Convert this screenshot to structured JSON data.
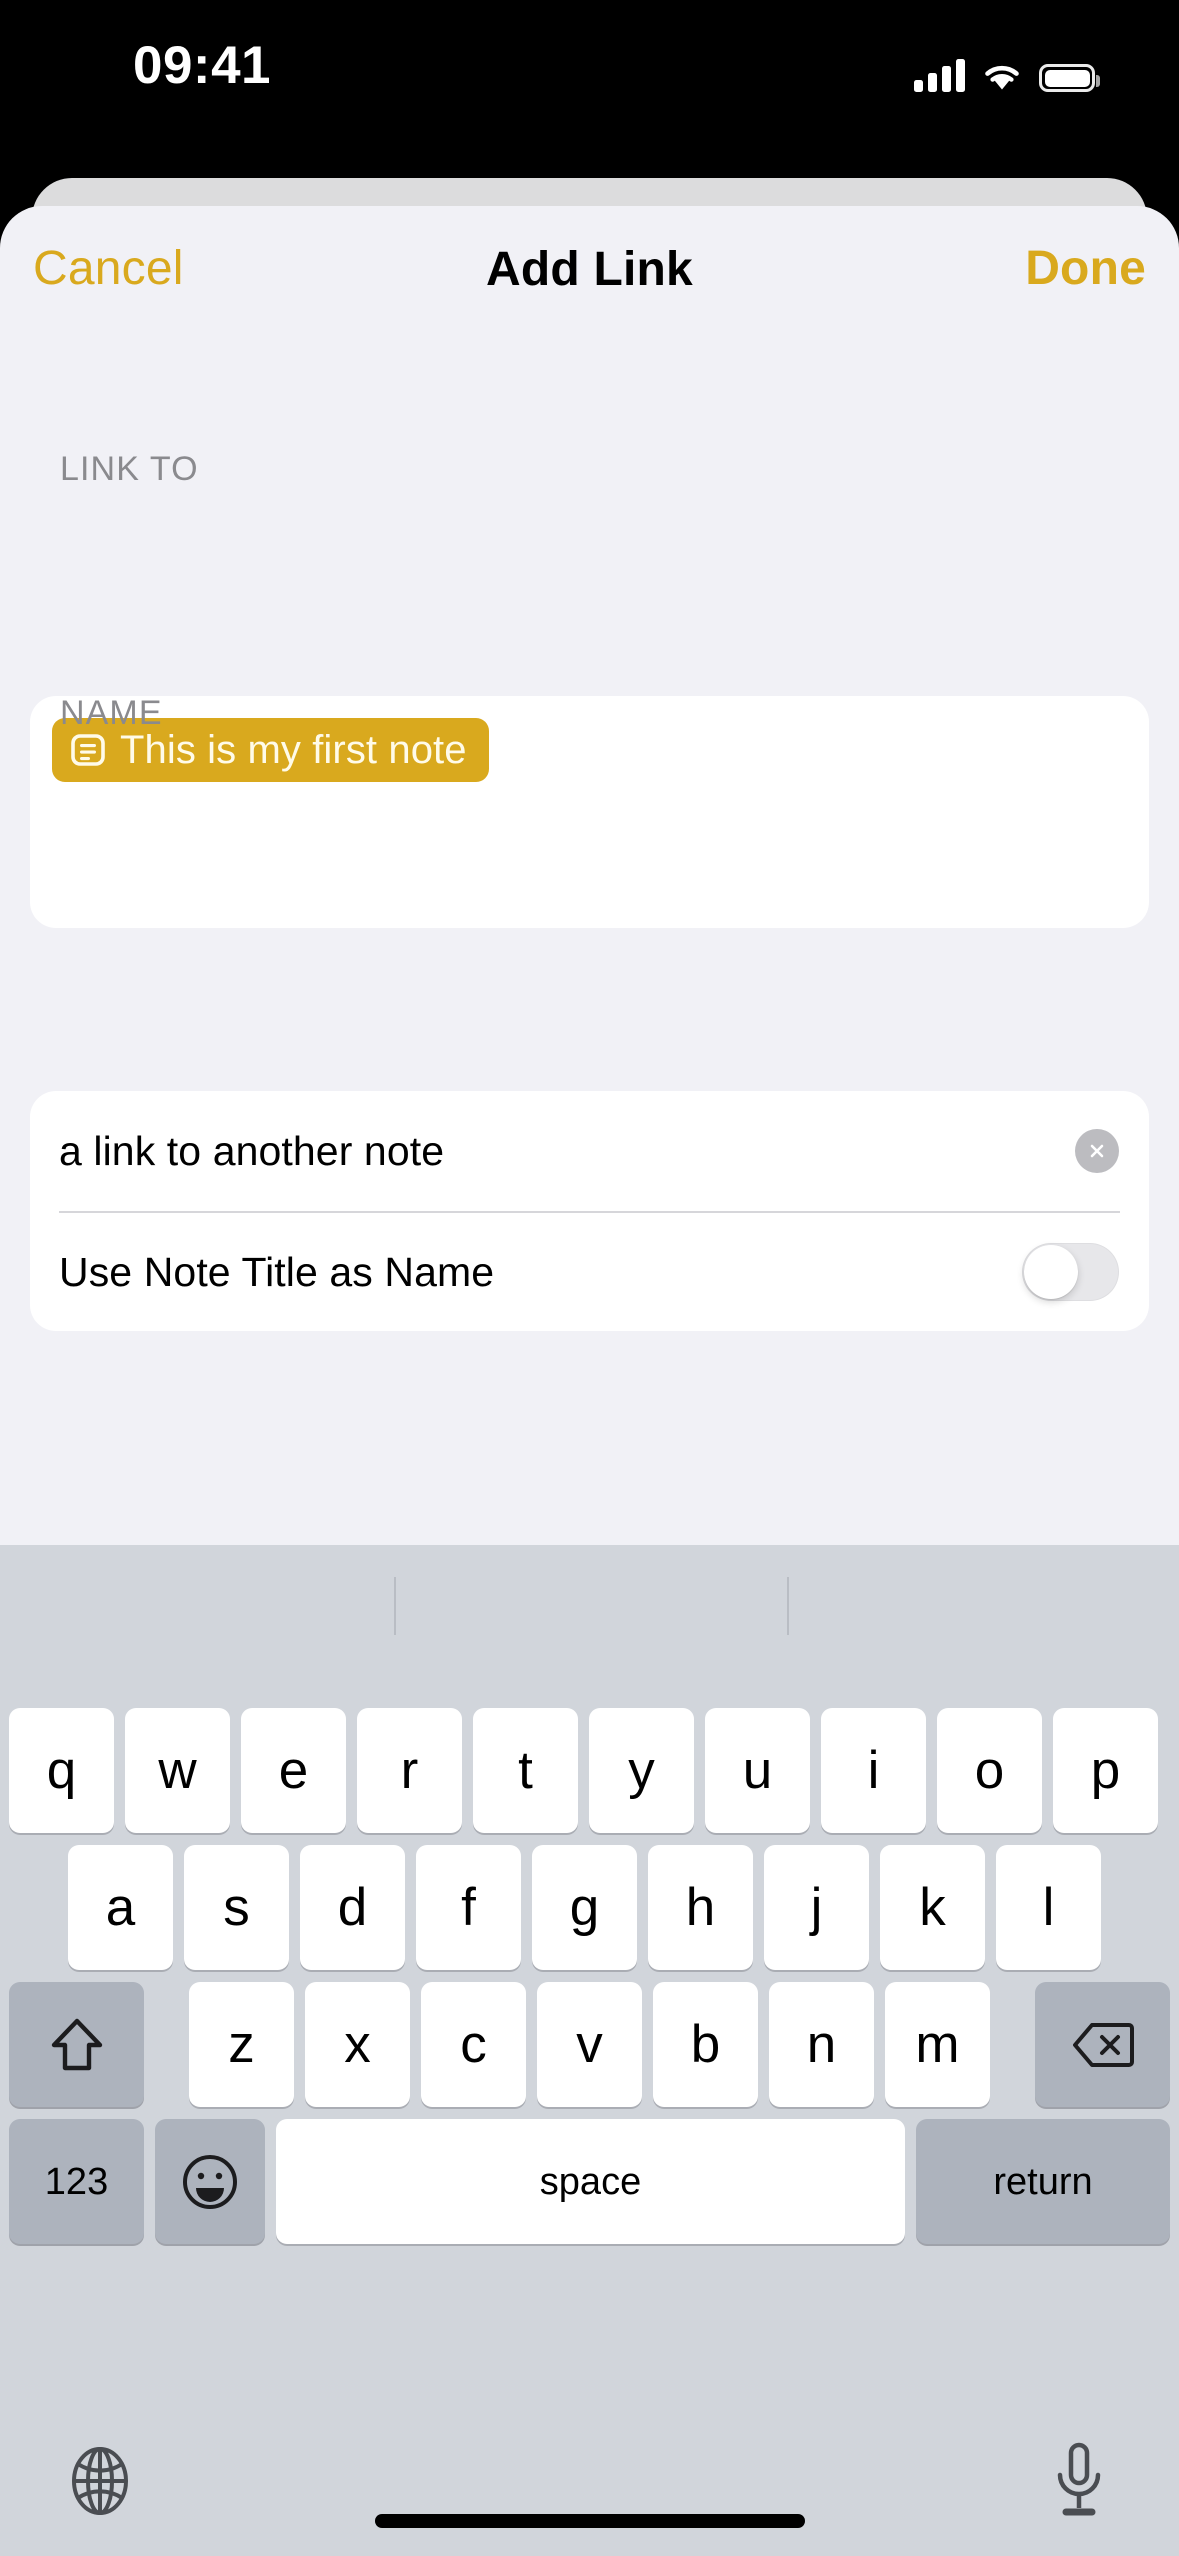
{
  "status_bar": {
    "time": "09:41",
    "cellular_icon": "cellular-signal-icon",
    "wifi_icon": "wifi-icon",
    "battery_icon": "battery-icon"
  },
  "nav": {
    "cancel_label": "Cancel",
    "title": "Add Link",
    "done_label": "Done",
    "accent_color": "#d9a91e"
  },
  "link_to": {
    "section_header": "LINK TO",
    "chip": {
      "icon": "note-document-icon",
      "label": "This is my first note",
      "background_color": "#d9a91e",
      "text_color": "#fffbe9"
    }
  },
  "name": {
    "section_header": "NAME",
    "field": {
      "value": "a link to another note",
      "placeholder": "Name",
      "clear_icon": "clear-circle-x-icon"
    },
    "toggle": {
      "label": "Use Note Title as Name",
      "state": "off",
      "track_color": "#e7e7ea"
    }
  },
  "keyboard": {
    "row1": [
      "q",
      "w",
      "e",
      "r",
      "t",
      "y",
      "u",
      "i",
      "o",
      "p"
    ],
    "row2": [
      "a",
      "s",
      "d",
      "f",
      "g",
      "h",
      "j",
      "k",
      "l"
    ],
    "row3": [
      "z",
      "x",
      "c",
      "v",
      "b",
      "n",
      "m"
    ],
    "shift_icon": "shift-arrow-icon",
    "delete_icon": "backspace-delete-icon",
    "numbers_label": "123",
    "emoji_icon": "emoji-smiley-icon",
    "space_label": "space",
    "return_label": "return",
    "globe_icon": "globe-language-icon",
    "mic_icon": "microphone-dictation-icon",
    "background_color": "#d1d5db"
  }
}
